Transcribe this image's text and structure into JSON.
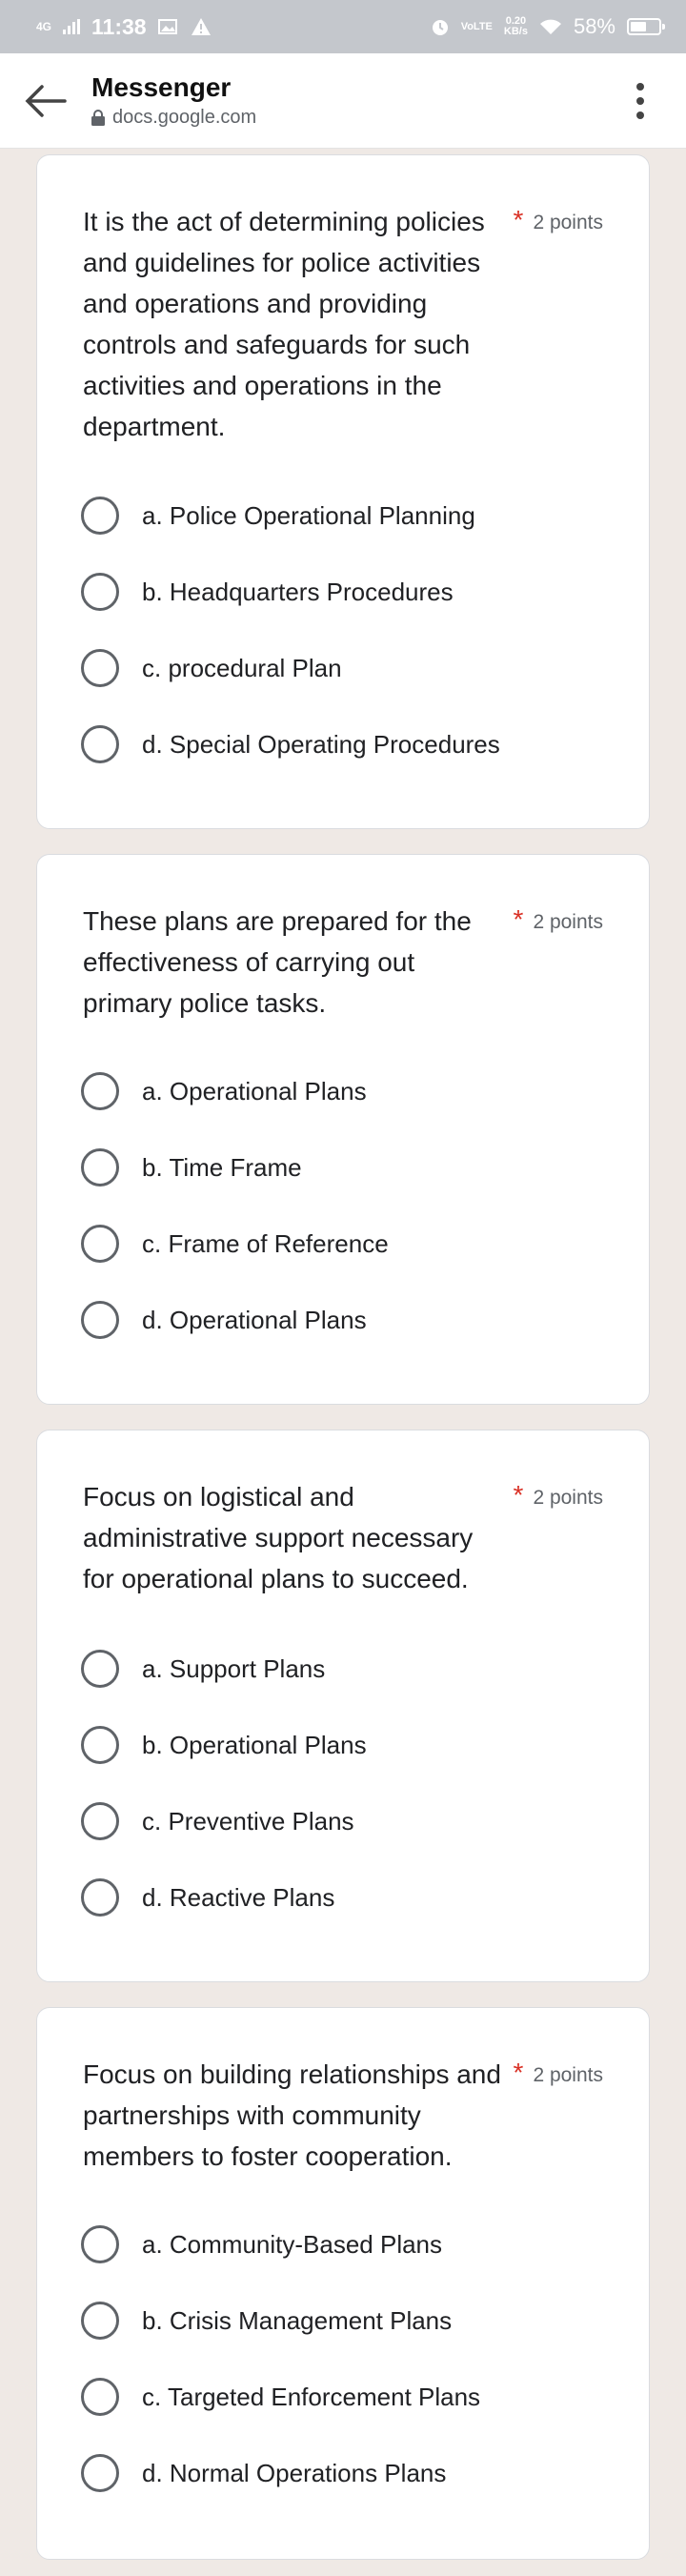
{
  "status_bar": {
    "network": "4G",
    "time": "11:38",
    "volte": "VoLTE",
    "speed_value": "0.20",
    "speed_unit": "KB/s",
    "battery_level": "58%",
    "battery_fraction": 0.58
  },
  "app_bar": {
    "title": "Messenger",
    "url": "docs.google.com"
  },
  "questions": [
    {
      "text": "It is the act of determining policies and guidelines for police activities and operations and providing controls and safeguards for such activities and operations in the department.",
      "required_mark": "*",
      "points": "2 points",
      "options": [
        "a. Police Operational Planning",
        "b. Headquarters Procedures",
        "c. procedural Plan",
        "d. Special Operating Procedures"
      ]
    },
    {
      "text": "These plans are prepared for the effectiveness of carrying out primary police tasks.",
      "required_mark": "*",
      "points": "2 points",
      "options": [
        "a. Operational Plans",
        "b. Time Frame",
        "c. Frame of Reference",
        "d. Operational Plans"
      ]
    },
    {
      "text": "Focus on logistical and administrative support necessary for operational plans to succeed.",
      "required_mark": "*",
      "points": "2 points",
      "options": [
        "a. Support Plans",
        "b. Operational Plans",
        "c. Preventive Plans",
        "d. Reactive Plans"
      ]
    },
    {
      "text": "Focus on building relationships and partnerships with community members to foster cooperation.",
      "required_mark": "*",
      "points": "2 points",
      "options": [
        "a. Community-Based Plans",
        "b. Crisis Management Plans",
        "c. Targeted Enforcement Plans",
        "d. Normal Operations Plans"
      ]
    }
  ]
}
